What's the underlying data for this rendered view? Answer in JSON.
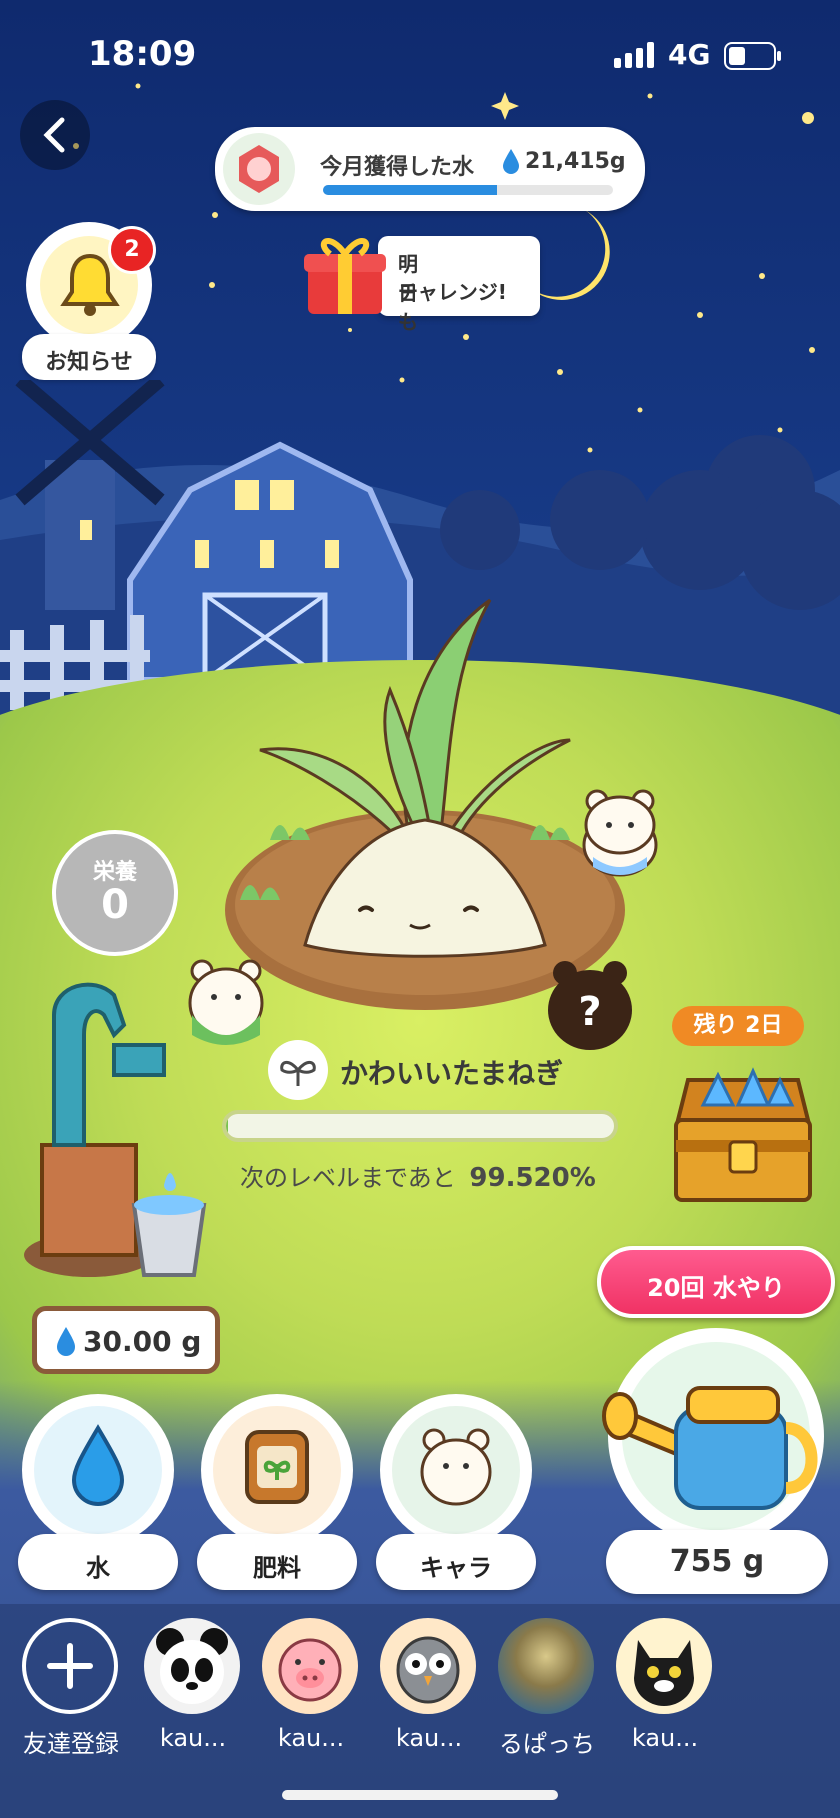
{
  "status_bar": {
    "time": "18:09",
    "network": "4G"
  },
  "header": {
    "monthly_water_label": "今月獲得した水",
    "monthly_water_value": "21,415g",
    "monthly_water_progress": 0.6
  },
  "bonus": {
    "label_line1": "明日も",
    "label_line2": "チャレンジ!"
  },
  "notification": {
    "label": "お知らせ",
    "badge_count": "2"
  },
  "nutrition": {
    "label": "栄養",
    "value": "0"
  },
  "plant": {
    "name": "かわいいたまねぎ",
    "next_level_label": "次のレベルまであと",
    "next_level_value": "99.520%",
    "progress": 0.0048
  },
  "treasure": {
    "remaining_label": "残り 2日"
  },
  "pump": {
    "water_amount": "30.00 g"
  },
  "watering": {
    "repeat_button": "20回 水やり",
    "amount": "755 g"
  },
  "actions": [
    {
      "label": "水"
    },
    {
      "label": "肥料"
    },
    {
      "label": "キャラ"
    }
  ],
  "friends": {
    "add_label": "友達登録",
    "items": [
      {
        "name": "kau..."
      },
      {
        "name": "kau..."
      },
      {
        "name": "kau..."
      },
      {
        "name": "るぱっち"
      },
      {
        "name": "kau..."
      }
    ]
  },
  "colors": {
    "accent_pink": "#ff3e73",
    "water_blue": "#1e88e5",
    "grass": "#c9e05a"
  }
}
